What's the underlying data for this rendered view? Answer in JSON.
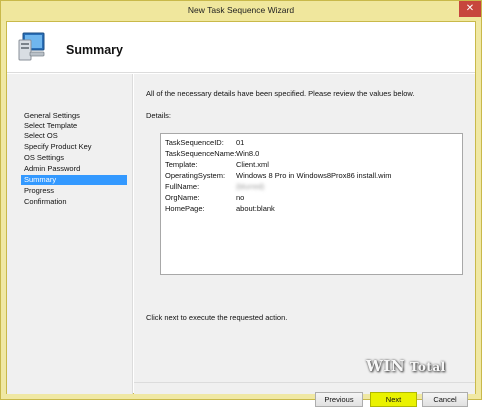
{
  "window": {
    "title": "New Task Sequence Wizard",
    "close_glyph": "✕"
  },
  "header": {
    "title": "Summary",
    "icon": "computer-icon"
  },
  "nav": {
    "items": [
      "General Settings",
      "Select Template",
      "Select OS",
      "Specify Product Key",
      "OS Settings",
      "Admin Password",
      "Summary",
      "Progress",
      "Confirmation"
    ],
    "selected": "Summary"
  },
  "content": {
    "intro": "All of the necessary details have been specified.  Please review the values below.",
    "details_label": "Details:",
    "details": [
      {
        "key": "TaskSequenceID:",
        "value": "01"
      },
      {
        "key": "TaskSequenceName:",
        "value": "Win8.0"
      },
      {
        "key": "Template:",
        "value": "Client.xml"
      },
      {
        "key": "OperatingSystem:",
        "value": "Windows 8 Pro in Windows8Prox86 install.wim"
      },
      {
        "key": "FullName:",
        "value": "(blurred)"
      },
      {
        "key": "OrgName:",
        "value": "no"
      },
      {
        "key": "HomePage:",
        "value": "about:blank"
      }
    ],
    "footer_note": "Click next to execute the requested action."
  },
  "watermark": {
    "part1": "WIN",
    "part2": "Total"
  },
  "buttons": {
    "previous": "Previous",
    "next": "Next",
    "cancel": "Cancel"
  },
  "colors": {
    "frame": "#f0e79d",
    "selection": "#3399ff",
    "next_button": "#eaf200",
    "close_button": "#c7463d"
  }
}
